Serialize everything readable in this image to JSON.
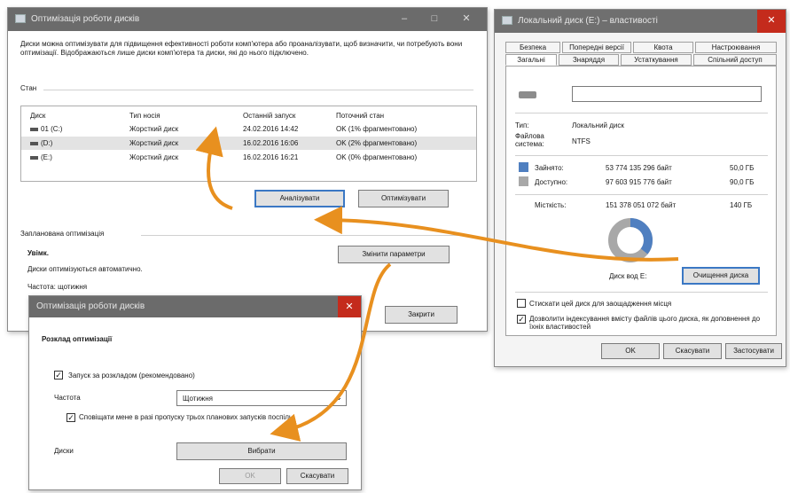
{
  "colors": {
    "titlebar_bg": "#6b6b6b",
    "close_red": "#c42b1c",
    "arrow_orange": "#e8901f",
    "used_blue": "#4f7fc0",
    "free_gray": "#a8a8a8",
    "focus_blue": "#3b78c4"
  },
  "optimize_window": {
    "title": "Оптимізація роботи дисків",
    "description": "Диски можна оптимізувати для підвищення ефективності роботи комп'ютера або проаналізувати, щоб визначити, чи потребують вони оптимізації. Відображаються лише диски комп'ютера та диски, які до нього підключено.",
    "status_label": "Стан",
    "columns": [
      "Диск",
      "Тип носія",
      "Останній запуск",
      "Поточний стан"
    ],
    "rows": [
      [
        "01 (C:)",
        "Жорсткий диск",
        "24.02.2016 14:42",
        "OK (1% фрагментовано)"
      ],
      [
        "(D:)",
        "Жорсткий диск",
        "16.02.2016 16:06",
        "OK (2% фрагментовано)"
      ],
      [
        "(E:)",
        "Жорсткий диск",
        "16.02.2016 16:21",
        "OK (0% фрагментовано)"
      ]
    ],
    "analyze_button": "Аналізувати",
    "optimize_button": "Оптимізувати",
    "scheduled_label": "Запланована оптимізація",
    "on_label": "Увімк.",
    "auto_text": "Диски оптимізуються автоматично.",
    "frequency_text": "Частота: щотижня",
    "change_settings_button": "Змінити параметри",
    "close_button": "Закрити"
  },
  "properties_window": {
    "title": "Локальний диск (E:) – властивості",
    "tabs_row1": [
      "Безпека",
      "Попередні версії",
      "Квота",
      "Настроювання"
    ],
    "tabs_row2": [
      "Загальні",
      "Знаряддя",
      "Устаткування",
      "Спільний доступ"
    ],
    "name_value": "",
    "type_label": "Тип:",
    "type_value": "Локальний диск",
    "fs_label": "Файлова система:",
    "fs_value": "NTFS",
    "used_label": "Зайнято:",
    "used_bytes": "53 774 135 296 байт",
    "used_gb": "50,0 ГБ",
    "free_label": "Доступно:",
    "free_bytes": "97 603 915 776 байт",
    "free_gb": "90,0 ГБ",
    "capacity_label": "Місткість:",
    "capacity_bytes": "151 378 051 072 байт",
    "capacity_gb": "140 ГБ",
    "used_fraction": 0.357,
    "drive_label": "Диск вод E:",
    "cleanup_button": "Очищення диска",
    "compress_label": "Стискати цей диск для заощадження місця",
    "index_label": "Дозволити індексування вмісту файлів цього диска, як доповнення до їхніх властивостей",
    "compress_checked": false,
    "index_checked": true,
    "ok_button": "OK",
    "cancel_button": "Скасувати",
    "apply_button": "Застосувати"
  },
  "schedule_window": {
    "title": "Оптимізація роботи дисків",
    "heading": "Розклад оптимізації",
    "run_on_schedule_label": "Запуск за розкладом (рекомендовано)",
    "run_on_schedule_checked": true,
    "frequency_label": "Частота",
    "frequency_value": "Щотижня",
    "notify_label": "Сповіщати мене в разі пропуску трьох планових запусків поспіль",
    "notify_checked": true,
    "drives_label": "Диски",
    "choose_button": "Вибрати",
    "ok_button": "OK",
    "cancel_button": "Скасувати"
  }
}
